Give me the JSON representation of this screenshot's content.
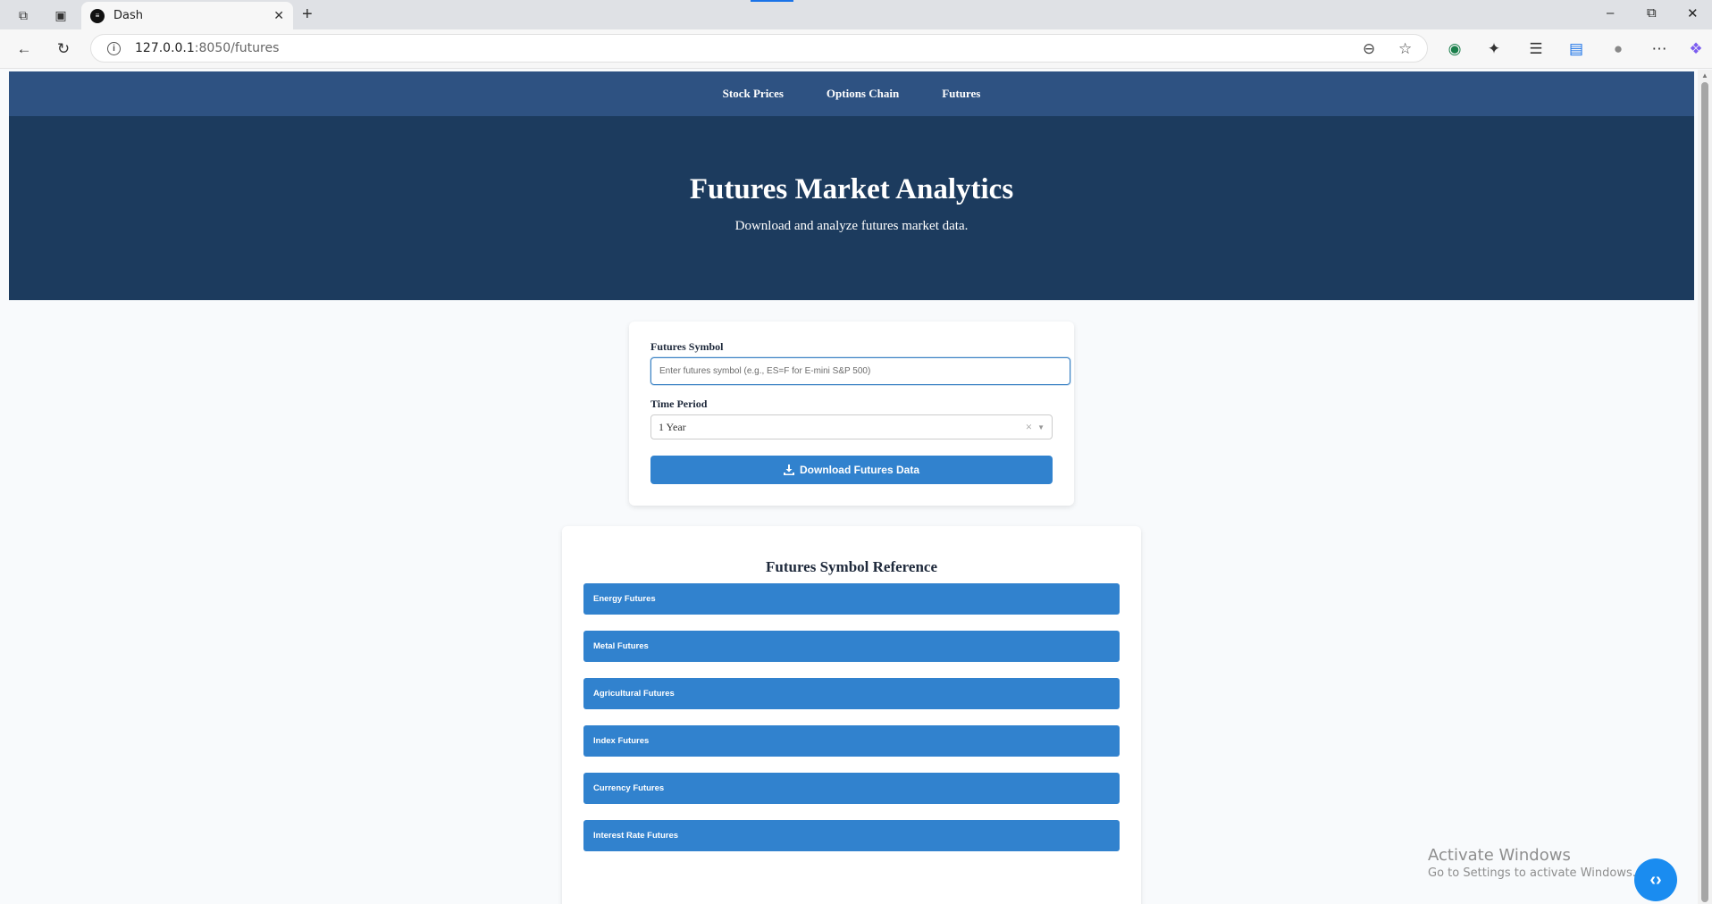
{
  "browser": {
    "tab_title": "Dash",
    "tab_favicon": "dash-logo",
    "url_host": "127.0.0.1",
    "url_rest": ":8050/futures"
  },
  "nav": {
    "items": [
      "Stock Prices",
      "Options Chain",
      "Futures"
    ]
  },
  "hero": {
    "title": "Futures Market Analytics",
    "subtitle": "Download and analyze futures market data."
  },
  "form": {
    "symbol_label": "Futures Symbol",
    "symbol_placeholder": "Enter futures symbol (e.g., ES=F for E-mini S&P 500)",
    "symbol_value": "",
    "period_label": "Time Period",
    "period_value": "1 Year",
    "download_label": "Download Futures Data"
  },
  "reference": {
    "title": "Futures Symbol Reference",
    "sections": [
      "Energy Futures",
      "Metal Futures",
      "Agricultural Futures",
      "Index Futures",
      "Currency Futures",
      "Interest Rate Futures"
    ]
  },
  "overlay": {
    "watermark_line1": "Activate Windows",
    "watermark_line2": "Go to Settings to activate Windows."
  },
  "colors": {
    "navbar": "#2e5282",
    "hero": "#1c3b5e",
    "primary_button": "#3182ce",
    "page_bg": "#f8fafc"
  }
}
